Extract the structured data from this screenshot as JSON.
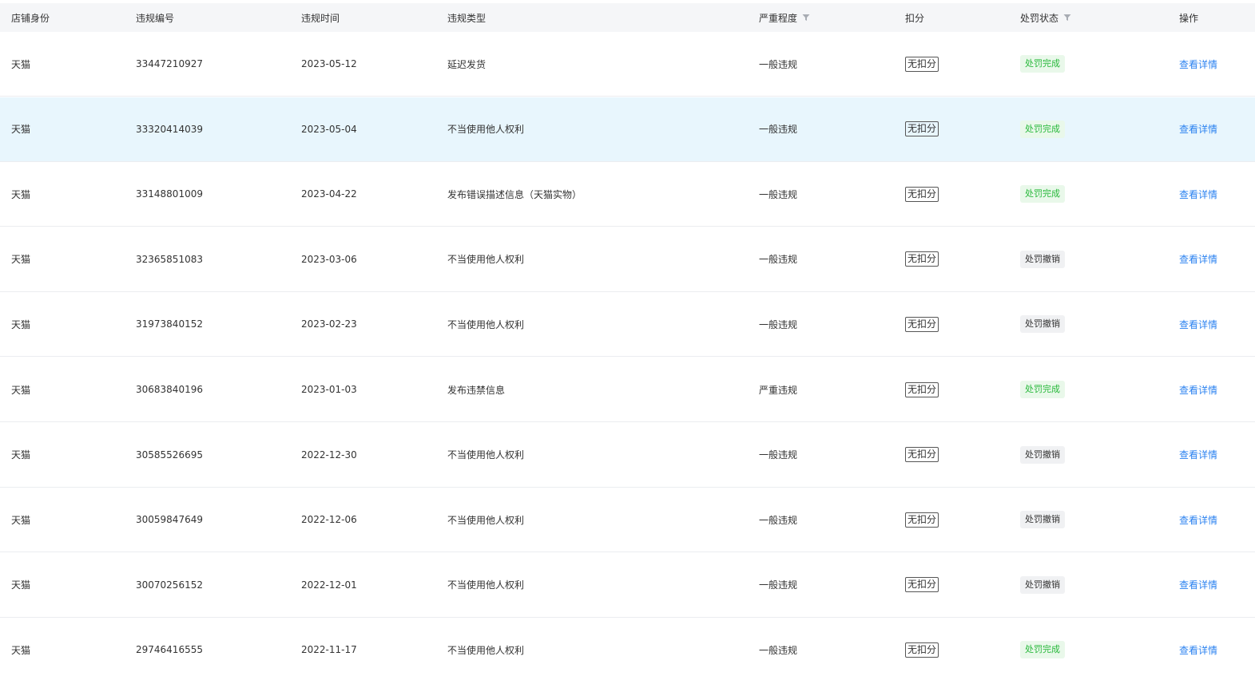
{
  "colors": {
    "header_bg": "#f5f6f8",
    "highlight_row_bg": "#e8f6fd",
    "status_done_bg": "#e9f8ea",
    "status_done_text": "#27b83a",
    "status_revoked_bg": "#f0f1f3",
    "link": "#2b82f0"
  },
  "columns": {
    "shop_identity": "店铺身份",
    "violation_id": "违规编号",
    "violation_time": "违规时间",
    "violation_type": "违规类型",
    "severity": "严重程度",
    "deduction": "扣分",
    "penalty_status": "处罚状态",
    "action": "操作"
  },
  "rows": [
    {
      "shop": "天猫",
      "id": "33447210927",
      "time": "2023-05-12",
      "type": "延迟发货",
      "severity": "一般违规",
      "deduction": "无扣分",
      "status": "处罚完成",
      "status_kind": "done",
      "action": "查看详情"
    },
    {
      "shop": "天猫",
      "id": "33320414039",
      "time": "2023-05-04",
      "type": "不当使用他人权利",
      "severity": "一般违规",
      "deduction": "无扣分",
      "status": "处罚完成",
      "status_kind": "done",
      "action": "查看详情"
    },
    {
      "shop": "天猫",
      "id": "33148801009",
      "time": "2023-04-22",
      "type": "发布错误描述信息（天猫实物）",
      "severity": "一般违规",
      "deduction": "无扣分",
      "status": "处罚完成",
      "status_kind": "done",
      "action": "查看详情"
    },
    {
      "shop": "天猫",
      "id": "32365851083",
      "time": "2023-03-06",
      "type": "不当使用他人权利",
      "severity": "一般违规",
      "deduction": "无扣分",
      "status": "处罚撤销",
      "status_kind": "revoked",
      "action": "查看详情"
    },
    {
      "shop": "天猫",
      "id": "31973840152",
      "time": "2023-02-23",
      "type": "不当使用他人权利",
      "severity": "一般违规",
      "deduction": "无扣分",
      "status": "处罚撤销",
      "status_kind": "revoked",
      "action": "查看详情"
    },
    {
      "shop": "天猫",
      "id": "30683840196",
      "time": "2023-01-03",
      "type": "发布违禁信息",
      "severity": "严重违规",
      "deduction": "无扣分",
      "status": "处罚完成",
      "status_kind": "done",
      "action": "查看详情"
    },
    {
      "shop": "天猫",
      "id": "30585526695",
      "time": "2022-12-30",
      "type": "不当使用他人权利",
      "severity": "一般违规",
      "deduction": "无扣分",
      "status": "处罚撤销",
      "status_kind": "revoked",
      "action": "查看详情"
    },
    {
      "shop": "天猫",
      "id": "30059847649",
      "time": "2022-12-06",
      "type": "不当使用他人权利",
      "severity": "一般违规",
      "deduction": "无扣分",
      "status": "处罚撤销",
      "status_kind": "revoked",
      "action": "查看详情"
    },
    {
      "shop": "天猫",
      "id": "30070256152",
      "time": "2022-12-01",
      "type": "不当使用他人权利",
      "severity": "一般违规",
      "deduction": "无扣分",
      "status": "处罚撤销",
      "status_kind": "revoked",
      "action": "查看详情"
    },
    {
      "shop": "天猫",
      "id": "29746416555",
      "time": "2022-11-17",
      "type": "不当使用他人权利",
      "severity": "一般违规",
      "deduction": "无扣分",
      "status": "处罚完成",
      "status_kind": "done",
      "action": "查看详情"
    }
  ],
  "highlighted_row": 1
}
